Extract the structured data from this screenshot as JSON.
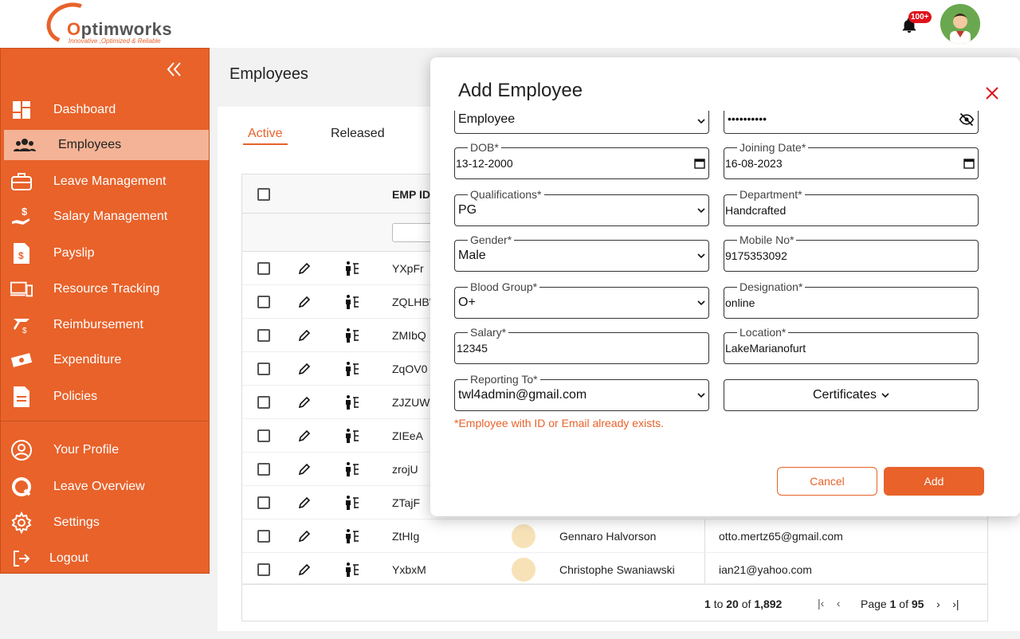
{
  "header": {
    "brand": "Optimworks",
    "brand_initial": "O",
    "brand_rest": "ptimworks",
    "tagline": "Innovative ,Optimized & Reliable",
    "notification_count": "100+",
    "bell_icon": "bell-icon",
    "avatar_icon": "user-avatar"
  },
  "sidebar": {
    "collapse_icon": "double-chevron-left-icon",
    "items": [
      {
        "label": "Dashboard",
        "icon": "dashboard-icon"
      },
      {
        "label": "Employees",
        "icon": "users-icon",
        "active": true
      },
      {
        "label": "Leave Management",
        "icon": "briefcase-icon"
      },
      {
        "label": "Salary Management",
        "icon": "salary-icon"
      },
      {
        "label": "Payslip",
        "icon": "payslip-icon"
      },
      {
        "label": "Resource Tracking",
        "icon": "devices-icon"
      },
      {
        "label": "Reimbursement",
        "icon": "reimbursement-icon"
      },
      {
        "label": "Expenditure",
        "icon": "money-icon"
      },
      {
        "label": "Policies",
        "icon": "document-icon"
      },
      {
        "label": "Your Profile",
        "icon": "profile-icon"
      },
      {
        "label": "Leave Overview",
        "icon": "overview-icon"
      },
      {
        "label": "Settings",
        "icon": "gear-icon"
      },
      {
        "label": "Logout",
        "icon": "logout-icon"
      }
    ]
  },
  "main": {
    "title": "Employees",
    "tabs": [
      {
        "label": "Active",
        "active": true
      },
      {
        "label": "Released"
      }
    ],
    "grid": {
      "header_empid": "EMP ID",
      "rows": [
        {
          "id": "YXpFr",
          "name": "",
          "email": ""
        },
        {
          "id": "ZQLHB'",
          "name": "",
          "email": ""
        },
        {
          "id": "ZMIbQ",
          "name": "",
          "email": ""
        },
        {
          "id": "ZqOV0",
          "name": "",
          "email": ""
        },
        {
          "id": "ZJZUW",
          "name": "",
          "email": ""
        },
        {
          "id": "ZIEeA",
          "name": "",
          "email": ""
        },
        {
          "id": "zrojU",
          "name": "",
          "email": ""
        },
        {
          "id": "ZTajF",
          "name": "",
          "email": ""
        },
        {
          "id": "ZtHIg",
          "name": "Gennaro Halvorson",
          "email": "otto.mertz65@gmail.com"
        },
        {
          "id": "YxbxM",
          "name": "Christophe Swaniawski",
          "email": "ian21@yahoo.com"
        }
      ],
      "footer": {
        "range_from": "1",
        "range_to_word": "to",
        "range_to": "20",
        "of_word": "of",
        "total": "1,892",
        "page_word": "Page",
        "page": "1",
        "page_of_word": "of",
        "pages": "95"
      }
    }
  },
  "modal": {
    "title": "Add Employee",
    "close_icon": "close-icon",
    "fields": {
      "role": {
        "value": "Employee"
      },
      "password": {
        "value": "••••••••••"
      },
      "dob": {
        "label": "DOB*",
        "value": "13-12-2000"
      },
      "joining_date": {
        "label": "Joining Date*",
        "value": "16-08-2023"
      },
      "qualifications": {
        "label": "Qualifications*",
        "value": "PG"
      },
      "department": {
        "label": "Department*",
        "value": "Handcrafted"
      },
      "gender": {
        "label": "Gender*",
        "value": "Male"
      },
      "mobile": {
        "label": "Mobile No*",
        "value": "9175353092"
      },
      "blood_group": {
        "label": "Blood Group*",
        "value": "O+"
      },
      "designation": {
        "label": "Designation*",
        "value": "online"
      },
      "salary": {
        "label": "Salary*",
        "value": "12345"
      },
      "location": {
        "label": "Location*",
        "value": "LakeMarianofurt"
      },
      "reporting_to": {
        "label": "Reporting To*",
        "value": "twl4admin@gmail.com"
      }
    },
    "certificates_label": "Certificates",
    "error": "*Employee with ID or Email already exists.",
    "cancel_label": "Cancel",
    "add_label": "Add"
  },
  "colors": {
    "brand": "#e8622a",
    "error": "#e0121c"
  }
}
